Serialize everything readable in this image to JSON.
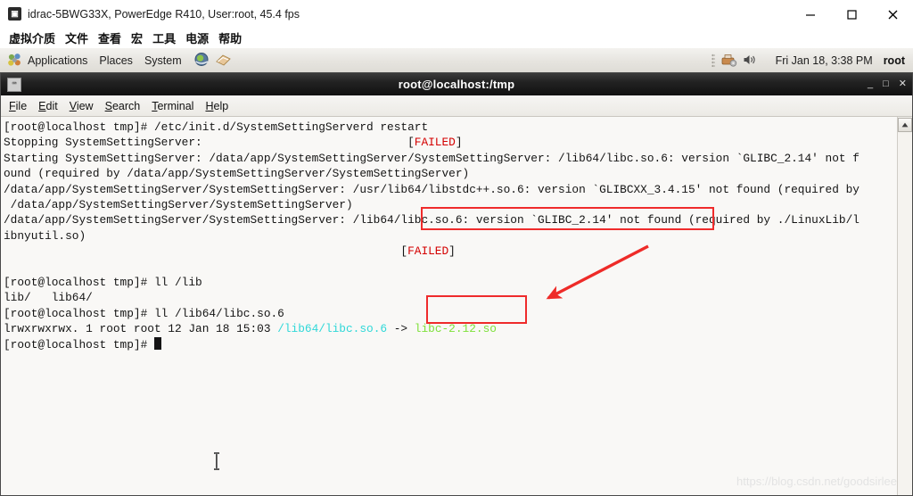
{
  "idrac": {
    "title": "idrac-5BWG33X, PowerEdge R410, User:root, 45.4 fps",
    "app_icon_glyph": "▣",
    "menus": [
      "虚拟介质",
      "文件",
      "查看",
      "宏",
      "工具",
      "电源",
      "帮助"
    ],
    "window_buttons": {
      "minimize": "minimize-icon",
      "maximize": "maximize-icon",
      "close": "close-icon"
    }
  },
  "gnome_panel": {
    "menus": [
      "Applications",
      "Places",
      "System"
    ],
    "launchers": [
      "web-browser-icon",
      "email-client-icon"
    ],
    "tray_icons": [
      "printer-icon",
      "volume-icon"
    ],
    "clock": "Fri Jan 18,  3:38 PM",
    "user": "root"
  },
  "terminal": {
    "title": "root@localhost:/tmp",
    "icon_glyph": "⌨",
    "menus": [
      {
        "pre": "",
        "accel": "F",
        "post": "ile"
      },
      {
        "pre": "",
        "accel": "E",
        "post": "dit"
      },
      {
        "pre": "",
        "accel": "V",
        "post": "iew"
      },
      {
        "pre": "",
        "accel": "S",
        "post": "earch"
      },
      {
        "pre": "",
        "accel": "T",
        "post": "erminal"
      },
      {
        "pre": "",
        "accel": "H",
        "post": "elp"
      }
    ],
    "window_buttons": {
      "minimize": "_",
      "maximize": "□",
      "close": "✕"
    },
    "scrollbar": {
      "up_arrow": "▲"
    },
    "lines": [
      [
        {
          "t": "[root@localhost tmp]# /etc/init.d/SystemSettingServerd restart"
        }
      ],
      [
        {
          "t": "Stopping SystemSettingServer:                              ["
        },
        {
          "t": "FAILED",
          "c": "c-red"
        },
        {
          "t": "]"
        }
      ],
      [
        {
          "t": "Starting SystemSettingServer: /data/app/SystemSettingServer/SystemSettingServer: /lib64/libc.so.6: version `GLIBC_2.14' not f"
        }
      ],
      [
        {
          "t": "ound (required by /data/app/SystemSettingServer/SystemSettingServer)"
        }
      ],
      [
        {
          "t": "/data/app/SystemSettingServer/SystemSettingServer: /usr/lib64/libstdc++.so.6: version `GLIBCXX_3.4.15' not found (required by"
        }
      ],
      [
        {
          "t": " /data/app/SystemSettingServer/SystemSettingServer)"
        }
      ],
      [
        {
          "t": "/data/app/SystemSettingServer/SystemSettingServer: /lib64/libc.so.6: version `GLIBC_2.14' not found (required by ./LinuxLib/l"
        }
      ],
      [
        {
          "t": "ibnyutil.so)"
        }
      ],
      [
        {
          "t": "                                                          ["
        },
        {
          "t": "FAILED",
          "c": "c-red"
        },
        {
          "t": "]"
        }
      ],
      [
        {
          "t": ""
        }
      ],
      [
        {
          "t": "[root@localhost tmp]# ll /lib"
        }
      ],
      [
        {
          "t": "lib/   lib64/"
        }
      ],
      [
        {
          "t": "[root@localhost tmp]# ll /lib64/libc.so.6"
        }
      ],
      [
        {
          "t": "lrwxrwxrwx. 1 root root 12 Jan 18 15:03 "
        },
        {
          "t": "/lib64/libc.so.6",
          "c": "c-cyan"
        },
        {
          "t": " -> "
        },
        {
          "t": "libc-2.12.so",
          "c": "c-green"
        }
      ],
      [
        {
          "t": "[root@localhost tmp]# "
        },
        {
          "cursor": true
        }
      ]
    ]
  },
  "annotations": {
    "highlight_version_error": "libc.so.6: version `GLIBC_2.14' not found",
    "highlight_symlink_target": "libc-2.12.so",
    "arrow": "red-arrow-pointing-to-symlink-target",
    "accent_color": "#ef2b2b"
  },
  "watermark": {
    "text": "https://blog.csdn.net/goodsirlee"
  },
  "mouse": {
    "cursor": "text-ibeam-cursor"
  }
}
